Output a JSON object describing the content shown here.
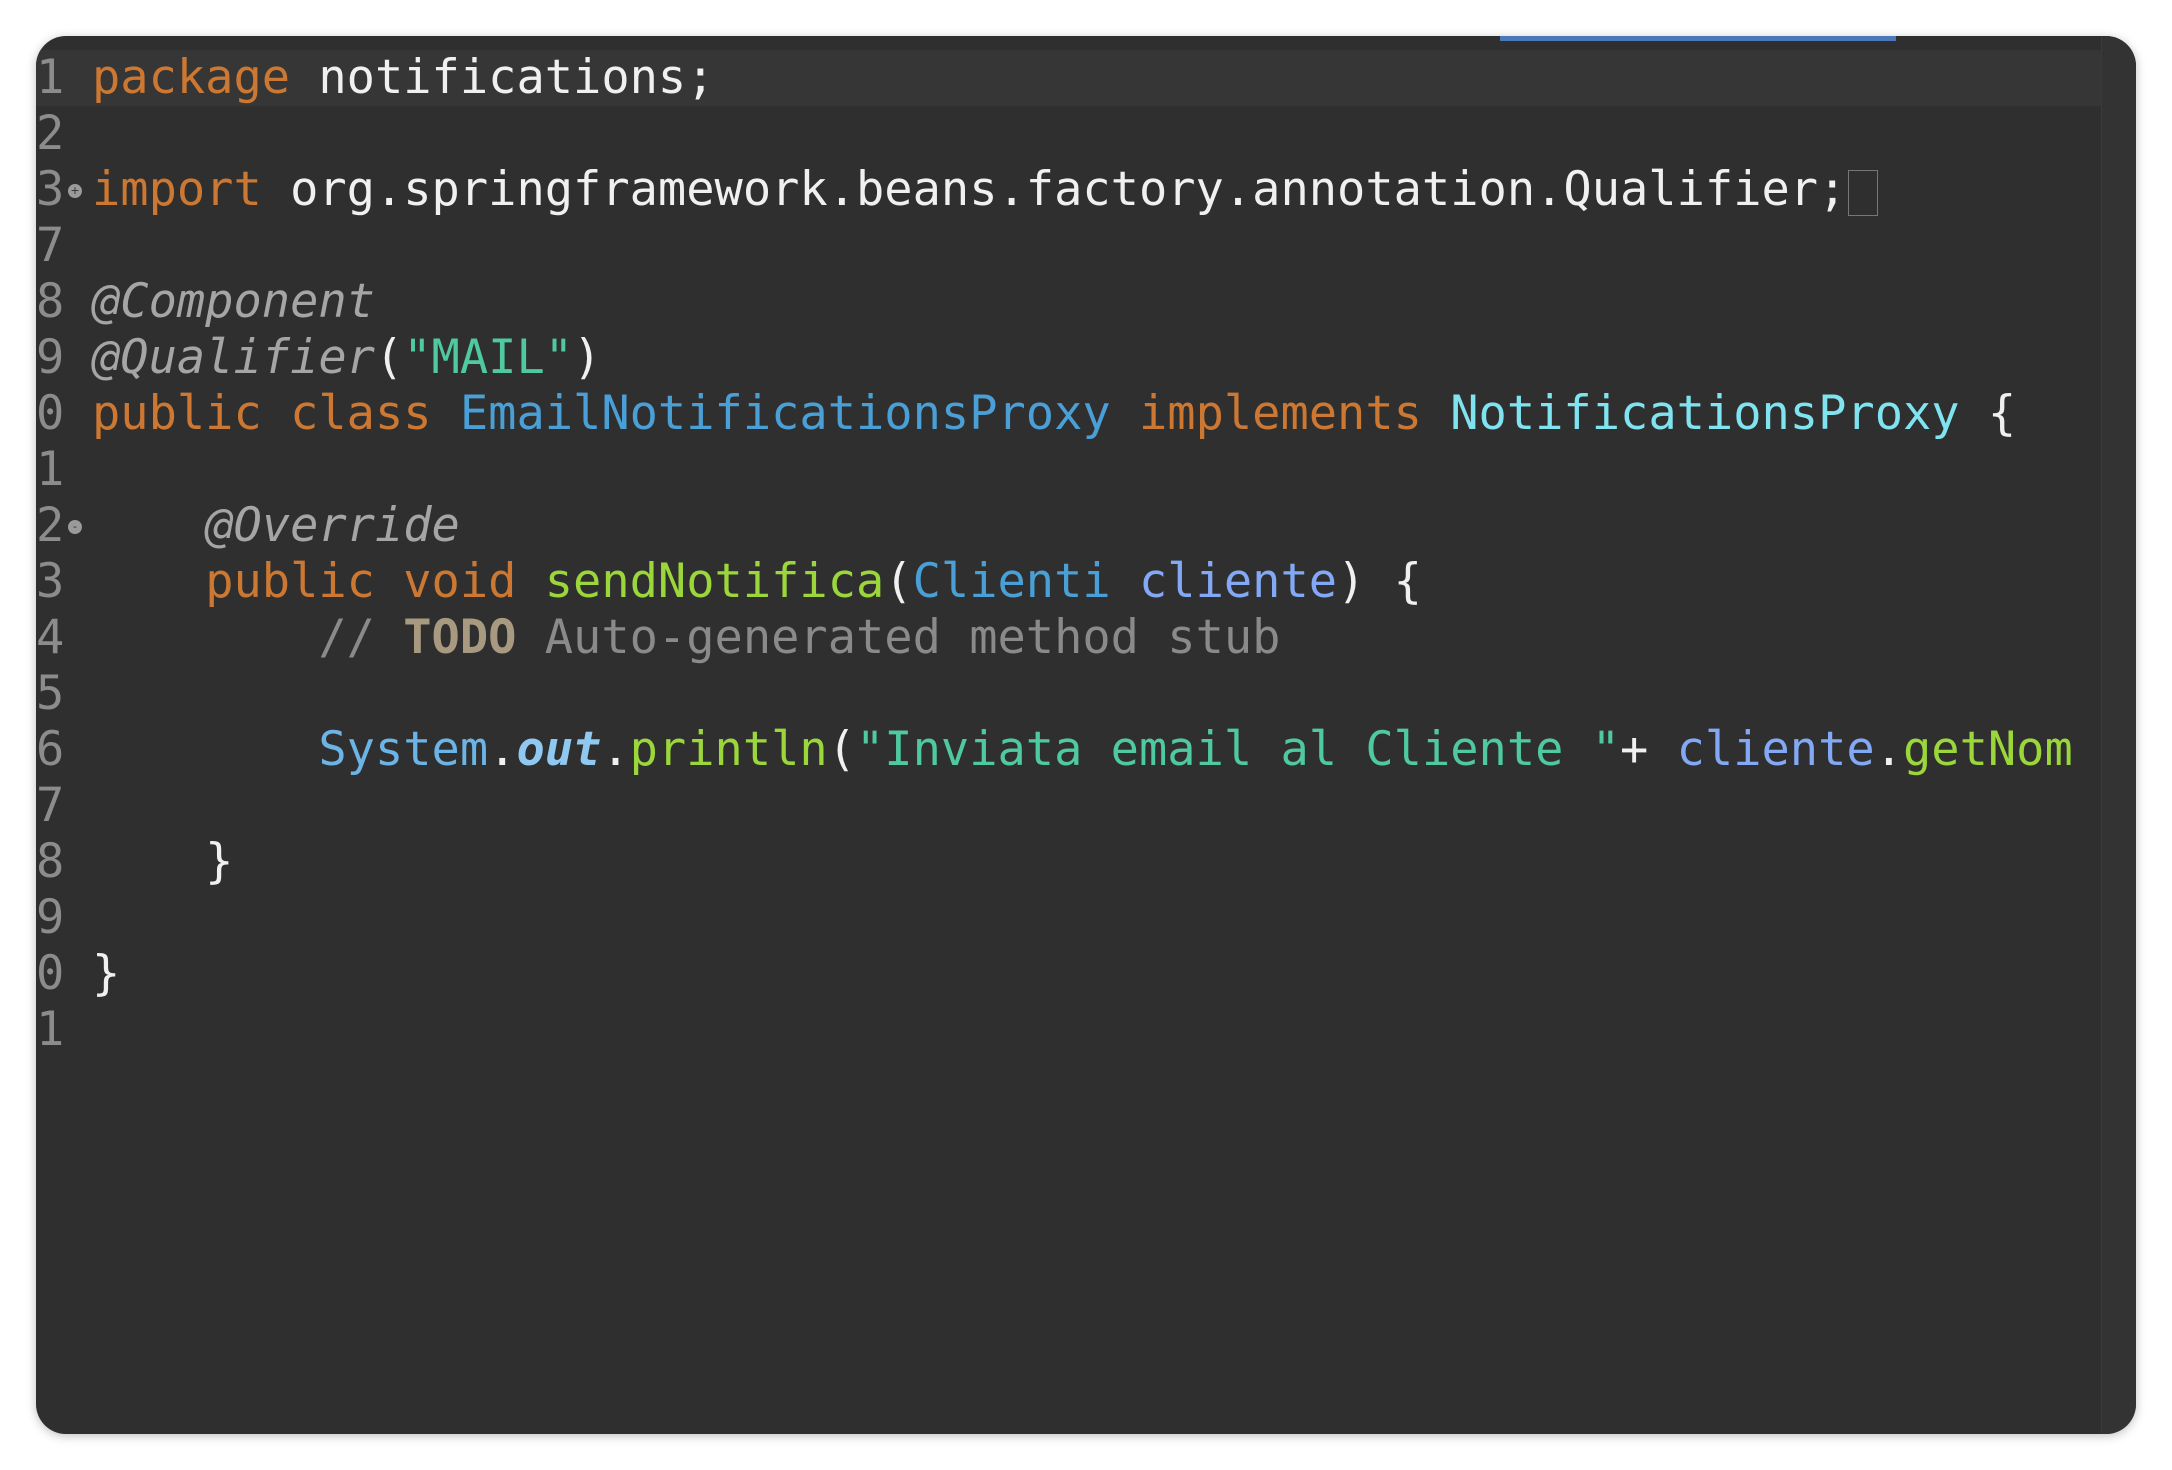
{
  "editor": {
    "lines": [
      {
        "number": "1",
        "tokens": [
          [
            "kw",
            "package"
          ],
          [
            "plain",
            " notifications;"
          ]
        ]
      },
      {
        "number": "2",
        "tokens": []
      },
      {
        "number": "3",
        "fold": "+",
        "tokens": [
          [
            "kw",
            "import"
          ],
          [
            "plain",
            " org.springframework.beans.factory.annotation.Qualifier;"
          ]
        ]
      },
      {
        "number": "7",
        "tokens": []
      },
      {
        "number": "8",
        "tokens": [
          [
            "ann",
            "@Component"
          ]
        ]
      },
      {
        "number": "9",
        "tokens": [
          [
            "ann",
            "@Qualifier"
          ],
          [
            "plain",
            "("
          ],
          [
            "str2",
            "\"MAIL\""
          ],
          [
            "plain",
            ")"
          ]
        ]
      },
      {
        "number": "0",
        "tokens": [
          [
            "kw",
            "public class "
          ],
          [
            "cls",
            "EmailNotificationsProxy"
          ],
          [
            "kw",
            " implements "
          ],
          [
            "iface",
            "NotificationsProxy"
          ],
          [
            "plain",
            " {"
          ]
        ]
      },
      {
        "number": "1",
        "tokens": []
      },
      {
        "number": "2",
        "fold": "-",
        "tokens": [
          [
            "plain",
            "    "
          ],
          [
            "ann",
            "@Override"
          ]
        ]
      },
      {
        "number": "3",
        "tokens": [
          [
            "plain",
            "    "
          ],
          [
            "kw",
            "public void "
          ],
          [
            "meth",
            "sendNotifica"
          ],
          [
            "plain",
            "("
          ],
          [
            "cls",
            "Clienti "
          ],
          [
            "param",
            "cliente"
          ],
          [
            "plain",
            ") {"
          ]
        ]
      },
      {
        "number": "4",
        "tokens": [
          [
            "plain",
            "        "
          ],
          [
            "comment",
            "// "
          ],
          [
            "todo",
            "TODO"
          ],
          [
            "comment",
            " Auto-generated method stub"
          ]
        ]
      },
      {
        "number": "5",
        "tokens": []
      },
      {
        "number": "6",
        "tokens": [
          [
            "plain",
            "        "
          ],
          [
            "sysout",
            "System"
          ],
          [
            "plain",
            "."
          ],
          [
            "static",
            "out"
          ],
          [
            "plain",
            "."
          ],
          [
            "meth",
            "println"
          ],
          [
            "plain",
            "("
          ],
          [
            "str2",
            "\"Inviata email al Cliente \""
          ],
          [
            "plain",
            "+ "
          ],
          [
            "param",
            "cliente"
          ],
          [
            "plain",
            "."
          ],
          [
            "meth",
            "getNom"
          ]
        ]
      },
      {
        "number": "7",
        "tokens": []
      },
      {
        "number": "8",
        "tokens": [
          [
            "plain",
            "    }"
          ]
        ]
      },
      {
        "number": "9",
        "tokens": []
      },
      {
        "number": "0",
        "tokens": [
          [
            "plain",
            "}"
          ]
        ]
      },
      {
        "number": "1",
        "tokens": []
      }
    ]
  }
}
